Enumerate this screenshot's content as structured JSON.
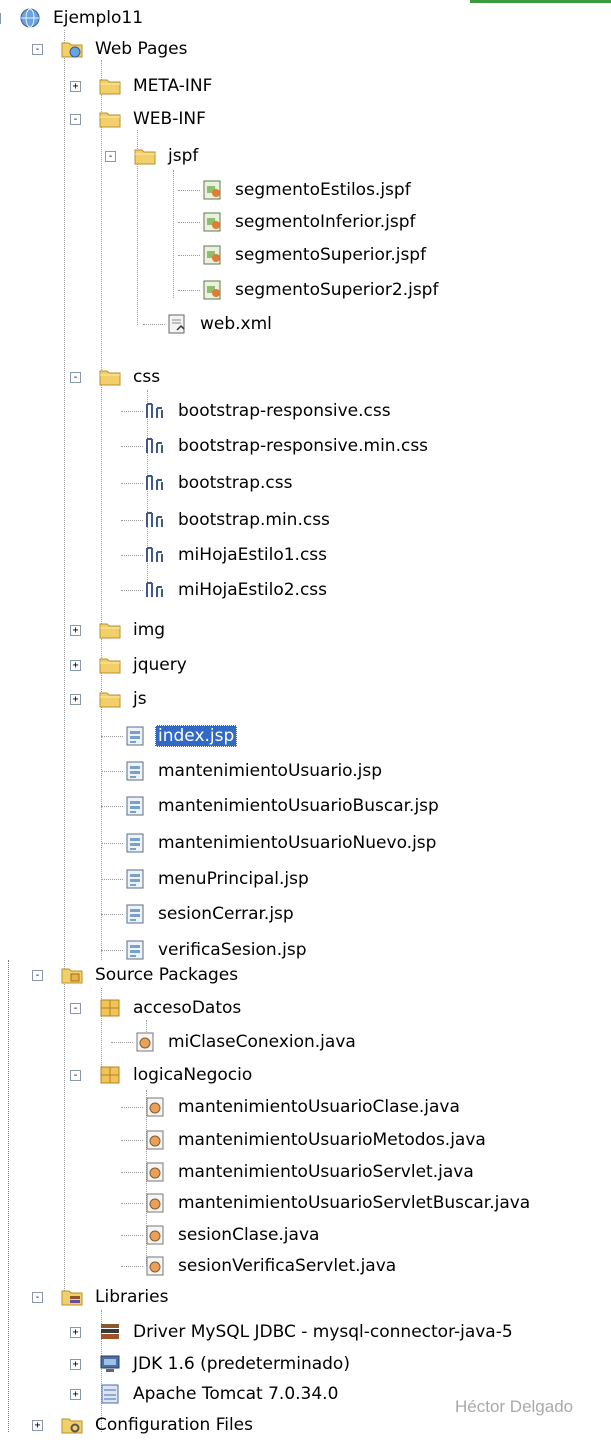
{
  "watermark": "Héctor Delgado",
  "colors": {
    "selection": "#316ac5",
    "folder": "#f3cf6a",
    "project_globe": "#4a86c9"
  },
  "tree": [
    {
      "label": "Ejemplo11",
      "icon": "globe-icon",
      "toggle": "-"
    },
    {
      "label": "Web Pages",
      "icon": "web-folder-icon",
      "toggle": "-"
    },
    {
      "label": "META-INF",
      "icon": "folder-icon",
      "toggle": "+"
    },
    {
      "label": "WEB-INF",
      "icon": "folder-icon",
      "toggle": "-"
    },
    {
      "label": "jspf",
      "icon": "folder-icon",
      "toggle": "-"
    },
    {
      "label": "segmentoEstilos.jspf",
      "icon": "jspf-file-icon"
    },
    {
      "label": "segmentoInferior.jspf",
      "icon": "jspf-file-icon"
    },
    {
      "label": "segmentoSuperior.jspf",
      "icon": "jspf-file-icon"
    },
    {
      "label": "segmentoSuperior2.jspf",
      "icon": "jspf-file-icon"
    },
    {
      "label": "web.xml",
      "icon": "xml-file-icon"
    },
    {
      "label": "css",
      "icon": "folder-icon",
      "toggle": "-"
    },
    {
      "label": "bootstrap-responsive.css",
      "icon": "css-file-icon"
    },
    {
      "label": "bootstrap-responsive.min.css",
      "icon": "css-file-icon"
    },
    {
      "label": "bootstrap.css",
      "icon": "css-file-icon"
    },
    {
      "label": "bootstrap.min.css",
      "icon": "css-file-icon"
    },
    {
      "label": "miHojaEstilo1.css",
      "icon": "css-file-icon"
    },
    {
      "label": "miHojaEstilo2.css",
      "icon": "css-file-icon"
    },
    {
      "label": "img",
      "icon": "folder-icon",
      "toggle": "+"
    },
    {
      "label": "jquery",
      "icon": "folder-icon",
      "toggle": "+"
    },
    {
      "label": "js",
      "icon": "folder-icon",
      "toggle": "+"
    },
    {
      "label": "index.jsp",
      "icon": "jsp-file-icon",
      "selected": true
    },
    {
      "label": "mantenimientoUsuario.jsp",
      "icon": "jsp-file-icon"
    },
    {
      "label": "mantenimientoUsuarioBuscar.jsp",
      "icon": "jsp-file-icon"
    },
    {
      "label": "mantenimientoUsuarioNuevo.jsp",
      "icon": "jsp-file-icon"
    },
    {
      "label": "menuPrincipal.jsp",
      "icon": "jsp-file-icon"
    },
    {
      "label": "sesionCerrar.jsp",
      "icon": "jsp-file-icon"
    },
    {
      "label": "verificaSesion.jsp",
      "icon": "jsp-file-icon"
    },
    {
      "label": "Source Packages",
      "icon": "source-folder-icon",
      "toggle": "-"
    },
    {
      "label": "accesoDatos",
      "icon": "package-icon",
      "toggle": "-"
    },
    {
      "label": "miClaseConexion.java",
      "icon": "java-file-icon"
    },
    {
      "label": "logicaNegocio",
      "icon": "package-icon",
      "toggle": "-"
    },
    {
      "label": "mantenimientoUsuarioClase.java",
      "icon": "java-file-icon"
    },
    {
      "label": "mantenimientoUsuarioMetodos.java",
      "icon": "java-file-icon"
    },
    {
      "label": "mantenimientoUsuarioServlet.java",
      "icon": "java-file-icon"
    },
    {
      "label": "mantenimientoUsuarioServletBuscar.java",
      "icon": "java-file-icon"
    },
    {
      "label": "sesionClase.java",
      "icon": "java-file-icon"
    },
    {
      "label": "sesionVerificaServlet.java",
      "icon": "java-file-icon"
    },
    {
      "label": "Libraries",
      "icon": "libraries-folder-icon",
      "toggle": "-"
    },
    {
      "label": "Driver MySQL JDBC  - mysql-connector-java-5",
      "icon": "jar-library-icon",
      "toggle": "+"
    },
    {
      "label": "JDK 1.6 (predeterminado)",
      "icon": "jdk-library-icon",
      "toggle": "+"
    },
    {
      "label": "Apache Tomcat 7.0.34.0",
      "icon": "server-library-icon",
      "toggle": "+"
    },
    {
      "label": "Configuration Files",
      "icon": "config-folder-icon",
      "toggle": "+"
    }
  ]
}
